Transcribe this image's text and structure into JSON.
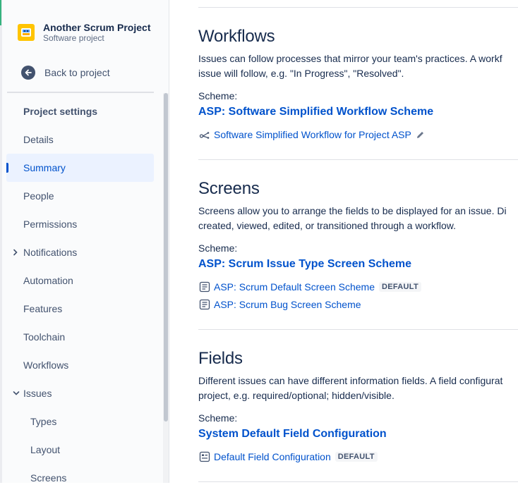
{
  "sidebar": {
    "project_name": "Another Scrum Project",
    "project_type": "Software project",
    "back_label": "Back to project",
    "heading": "Project settings",
    "items": [
      {
        "label": "Details"
      },
      {
        "label": "Summary",
        "active": true
      },
      {
        "label": "People"
      },
      {
        "label": "Permissions"
      },
      {
        "label": "Notifications",
        "chevron": "chevron-right"
      },
      {
        "label": "Automation"
      },
      {
        "label": "Features"
      },
      {
        "label": "Toolchain"
      },
      {
        "label": "Workflows"
      },
      {
        "label": "Issues",
        "chevron": "chevron-down"
      },
      {
        "label": "Types",
        "sub": true
      },
      {
        "label": "Layout",
        "sub": true
      },
      {
        "label": "Screens",
        "sub": true
      }
    ]
  },
  "main": {
    "workflows": {
      "title": "Workflows",
      "desc_line1": "Issues can follow processes that mirror your team's practices. A workf",
      "desc_line2": "issue will follow, e.g. \"In Progress\", \"Resolved\".",
      "scheme_label": "Scheme:",
      "scheme_name": "ASP: Software Simplified Workflow Scheme",
      "items": [
        {
          "label": "Software Simplified Workflow for Project ASP",
          "icon": "workflow-icon"
        }
      ]
    },
    "screens": {
      "title": "Screens",
      "desc_line1": "Screens allow you to arrange the fields to be displayed for an issue. Di",
      "desc_line2": "created, viewed, edited, or transitioned through a workflow.",
      "scheme_label": "Scheme:",
      "scheme_name": "ASP: Scrum Issue Type Screen Scheme",
      "items": [
        {
          "label": "ASP: Scrum Default Screen Scheme",
          "badge": "DEFAULT",
          "icon": "screen-icon"
        },
        {
          "label": "ASP: Scrum Bug Screen Scheme",
          "icon": "screen-icon"
        }
      ]
    },
    "fields": {
      "title": "Fields",
      "desc_line1": "Different issues can have different information fields. A field configurat",
      "desc_line2": "project, e.g. required/optional; hidden/visible.",
      "scheme_label": "Scheme:",
      "scheme_name": "System Default Field Configuration",
      "items": [
        {
          "label": "Default Field Configuration",
          "badge": "DEFAULT",
          "icon": "field-config-icon"
        }
      ]
    }
  },
  "colors": {
    "link": "#0052cc",
    "text": "#172b4d",
    "subtle": "#42526e",
    "active_bg": "#ebf2ff",
    "avatar": "#ffc400"
  }
}
